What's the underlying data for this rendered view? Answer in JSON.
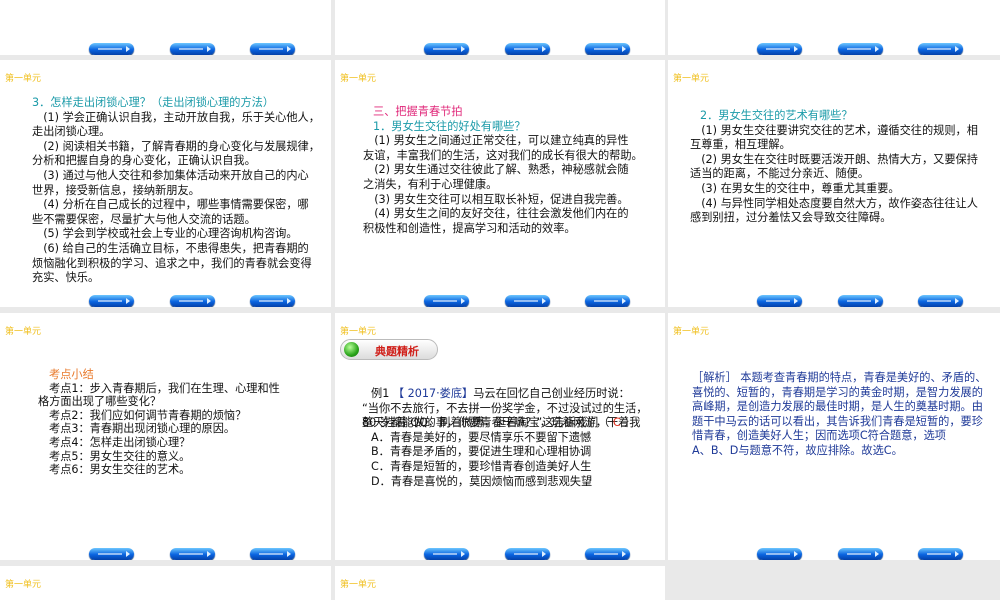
{
  "unit_label": "第一单元",
  "slides": {
    "s1": {
      "heading": "3．怎样走出闭锁心理？（走出闭锁心理的方法）",
      "lines": [
        "　(1) 学会正确认识自我，主动开放自我，乐于关心他人，",
        "走出闭锁心理。",
        "　(2) 阅读相关书籍，了解青春期的身心变化与发展规律，",
        "分析和把握自身的身心变化，正确认识自我。",
        "　(3) 通过与他人交往和参加集体活动来开放自己的内心",
        "世界，接受新信息，接纳新朋友。",
        "　(4) 分析在自己成长的过程中，哪些事情需要保密，哪",
        "些不需要保密，尽量扩大与他人交流的话题。",
        "　(5) 学会到学校或社会上专业的心理咨询机构咨询。",
        "　(6) 给自己的生活确立目标，不患得患失，把青春期的",
        "烦恼融化到积极的学习、追求之中，我们的青春就会变得",
        "充实、快乐。"
      ]
    },
    "s2": {
      "section": "三、把握青春节拍",
      "heading": "1．男女生交往的好处有哪些？",
      "lines": [
        "　(1) 男女生之间通过正常交往，可以建立纯真的异性",
        "友谊，丰富我们的生活，这对我们的成长有很大的帮助。",
        "　(2) 男女生通过交往彼此了解、熟悉，神秘感就会随",
        "之消失，有利于心理健康。",
        "　(3) 男女生交往可以相互取长补短，促进自我完善。",
        "　(4) 男女生之间的友好交往，往往会激发他们内在的",
        "积极性和创造性，提高学习和活动的效率。"
      ]
    },
    "s3": {
      "heading": "2．男女生交往的艺术有哪些？",
      "lines": [
        "　(1) 男女生交往要讲究交往的艺术，遵循交往的规则，相",
        "互尊重，相互理解。",
        "　(2) 男女生在交往时既要活泼开朗、热情大方，又要保持",
        "适当的距离，不能过分亲近、随便。",
        "　(3) 在男女生的交往中，尊重尤其重要。",
        "　(4) 与异性同学相处态度要自然大方，故作姿态往往让人",
        "感到别扭，过分羞怯又会导致交往障碍。"
      ]
    },
    "s4": {
      "heading": "考点小结",
      "lines": [
        "考点1：步入青春期后，我们在生理、心理和性",
        "格方面出现了哪些变化？",
        "考点2：我们应如何调节青春期的烦恼？",
        "考点3：青春期出现闭锁心理的原因。",
        "考点4：怎样走出闭锁心理？",
        "考点5：男女生交往的意义。",
        "考点6：男女生交往的艺术。"
      ]
    },
    "s5": {
      "banner": "典题精析",
      "q_prefix": "例1 ",
      "q_source": "【 2017·娄底】",
      "q_line1": "马云在回忆自己创业经历时说：",
      "lines": [
        "“当你不去旅行，不去拼一份奖学金，不过没试过的生活，",
        "整天挂着 QQ，刷着微博，逛着淘宝，玩着网游，干着我"
      ],
      "q_last": "80 岁都能做的事，你要青春干嘛？”这告诉我们（ ",
      "answer": "C",
      "q_close": " ）",
      "options": [
        "A．青春是美好的，要尽情享乐不要留下遗憾",
        "B．青春是矛盾的，要促进生理和心理相协调",
        "C．青春是短暂的，要珍惜青春创造美好人生",
        "D．青春是喜悦的，莫因烦恼而感到悲观失望"
      ]
    },
    "s6": {
      "lines": [
        "［解析］ 本题考查青春期的特点，青春是美好的、矛盾的、",
        "喜悦的、短暂的，青春期是学习的黄金时期，是智力发展的",
        "高峰期，是创造力发展的最佳时期，是人生的奠基时期。由",
        "题干中马云的话可以看出，其告诉我们青春是短暂的，要珍",
        "惜青春，创造美好人生；因而选项C符合题意，选项",
        "A、B、D与题意不符，故应排除。故选C。"
      ]
    }
  }
}
